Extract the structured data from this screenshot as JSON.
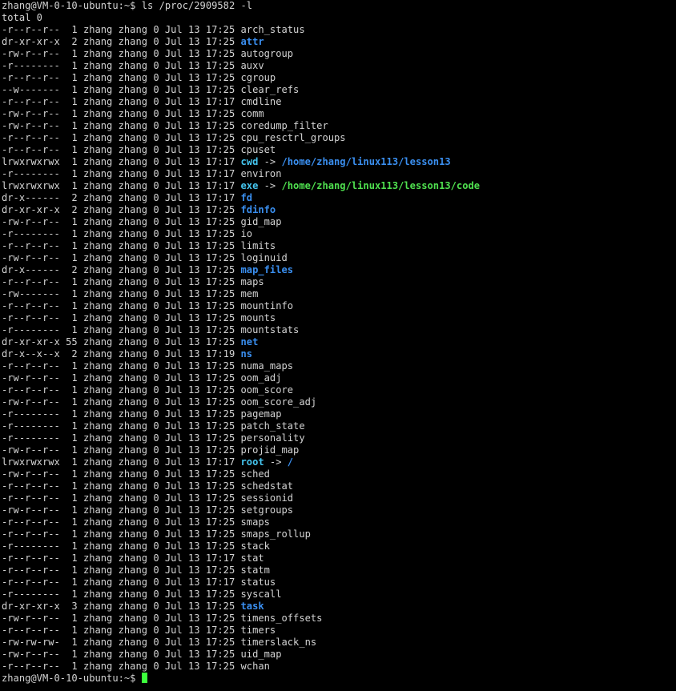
{
  "prompt": "zhang@VM-0-10-ubuntu:~$",
  "command": " ls /proc/2909582 -l",
  "total_line": "total 0",
  "entries": [
    {
      "perm": "-r--r--r--",
      "links": " 1",
      "owner": "zhang",
      "group": "zhang",
      "size": "0",
      "month": "Jul",
      "day": "13",
      "time": "17:25",
      "name": "arch_status",
      "type": "file"
    },
    {
      "perm": "dr-xr-xr-x",
      "links": " 2",
      "owner": "zhang",
      "group": "zhang",
      "size": "0",
      "month": "Jul",
      "day": "13",
      "time": "17:25",
      "name": "attr",
      "type": "dir"
    },
    {
      "perm": "-rw-r--r--",
      "links": " 1",
      "owner": "zhang",
      "group": "zhang",
      "size": "0",
      "month": "Jul",
      "day": "13",
      "time": "17:25",
      "name": "autogroup",
      "type": "file"
    },
    {
      "perm": "-r--------",
      "links": " 1",
      "owner": "zhang",
      "group": "zhang",
      "size": "0",
      "month": "Jul",
      "day": "13",
      "time": "17:25",
      "name": "auxv",
      "type": "file"
    },
    {
      "perm": "-r--r--r--",
      "links": " 1",
      "owner": "zhang",
      "group": "zhang",
      "size": "0",
      "month": "Jul",
      "day": "13",
      "time": "17:25",
      "name": "cgroup",
      "type": "file"
    },
    {
      "perm": "--w-------",
      "links": " 1",
      "owner": "zhang",
      "group": "zhang",
      "size": "0",
      "month": "Jul",
      "day": "13",
      "time": "17:25",
      "name": "clear_refs",
      "type": "file"
    },
    {
      "perm": "-r--r--r--",
      "links": " 1",
      "owner": "zhang",
      "group": "zhang",
      "size": "0",
      "month": "Jul",
      "day": "13",
      "time": "17:17",
      "name": "cmdline",
      "type": "file"
    },
    {
      "perm": "-rw-r--r--",
      "links": " 1",
      "owner": "zhang",
      "group": "zhang",
      "size": "0",
      "month": "Jul",
      "day": "13",
      "time": "17:25",
      "name": "comm",
      "type": "file"
    },
    {
      "perm": "-rw-r--r--",
      "links": " 1",
      "owner": "zhang",
      "group": "zhang",
      "size": "0",
      "month": "Jul",
      "day": "13",
      "time": "17:25",
      "name": "coredump_filter",
      "type": "file"
    },
    {
      "perm": "-r--r--r--",
      "links": " 1",
      "owner": "zhang",
      "group": "zhang",
      "size": "0",
      "month": "Jul",
      "day": "13",
      "time": "17:25",
      "name": "cpu_resctrl_groups",
      "type": "file"
    },
    {
      "perm": "-r--r--r--",
      "links": " 1",
      "owner": "zhang",
      "group": "zhang",
      "size": "0",
      "month": "Jul",
      "day": "13",
      "time": "17:25",
      "name": "cpuset",
      "type": "file"
    },
    {
      "perm": "lrwxrwxrwx",
      "links": " 1",
      "owner": "zhang",
      "group": "zhang",
      "size": "0",
      "month": "Jul",
      "day": "13",
      "time": "17:17",
      "name": "cwd",
      "type": "link",
      "arrow": " -> ",
      "target": "/home/zhang/linux113/lesson13",
      "target_type": "dir"
    },
    {
      "perm": "-r--------",
      "links": " 1",
      "owner": "zhang",
      "group": "zhang",
      "size": "0",
      "month": "Jul",
      "day": "13",
      "time": "17:17",
      "name": "environ",
      "type": "file"
    },
    {
      "perm": "lrwxrwxrwx",
      "links": " 1",
      "owner": "zhang",
      "group": "zhang",
      "size": "0",
      "month": "Jul",
      "day": "13",
      "time": "17:17",
      "name": "exe",
      "type": "link",
      "arrow": " -> ",
      "target": "/home/zhang/linux113/lesson13/code",
      "target_type": "exec"
    },
    {
      "perm": "dr-x------",
      "links": " 2",
      "owner": "zhang",
      "group": "zhang",
      "size": "0",
      "month": "Jul",
      "day": "13",
      "time": "17:17",
      "name": "fd",
      "type": "dir"
    },
    {
      "perm": "dr-xr-xr-x",
      "links": " 2",
      "owner": "zhang",
      "group": "zhang",
      "size": "0",
      "month": "Jul",
      "day": "13",
      "time": "17:25",
      "name": "fdinfo",
      "type": "dir"
    },
    {
      "perm": "-rw-r--r--",
      "links": " 1",
      "owner": "zhang",
      "group": "zhang",
      "size": "0",
      "month": "Jul",
      "day": "13",
      "time": "17:25",
      "name": "gid_map",
      "type": "file"
    },
    {
      "perm": "-r--------",
      "links": " 1",
      "owner": "zhang",
      "group": "zhang",
      "size": "0",
      "month": "Jul",
      "day": "13",
      "time": "17:25",
      "name": "io",
      "type": "file"
    },
    {
      "perm": "-r--r--r--",
      "links": " 1",
      "owner": "zhang",
      "group": "zhang",
      "size": "0",
      "month": "Jul",
      "day": "13",
      "time": "17:25",
      "name": "limits",
      "type": "file"
    },
    {
      "perm": "-rw-r--r--",
      "links": " 1",
      "owner": "zhang",
      "group": "zhang",
      "size": "0",
      "month": "Jul",
      "day": "13",
      "time": "17:25",
      "name": "loginuid",
      "type": "file"
    },
    {
      "perm": "dr-x------",
      "links": " 2",
      "owner": "zhang",
      "group": "zhang",
      "size": "0",
      "month": "Jul",
      "day": "13",
      "time": "17:25",
      "name": "map_files",
      "type": "dir"
    },
    {
      "perm": "-r--r--r--",
      "links": " 1",
      "owner": "zhang",
      "group": "zhang",
      "size": "0",
      "month": "Jul",
      "day": "13",
      "time": "17:25",
      "name": "maps",
      "type": "file"
    },
    {
      "perm": "-rw-------",
      "links": " 1",
      "owner": "zhang",
      "group": "zhang",
      "size": "0",
      "month": "Jul",
      "day": "13",
      "time": "17:25",
      "name": "mem",
      "type": "file"
    },
    {
      "perm": "-r--r--r--",
      "links": " 1",
      "owner": "zhang",
      "group": "zhang",
      "size": "0",
      "month": "Jul",
      "day": "13",
      "time": "17:25",
      "name": "mountinfo",
      "type": "file"
    },
    {
      "perm": "-r--r--r--",
      "links": " 1",
      "owner": "zhang",
      "group": "zhang",
      "size": "0",
      "month": "Jul",
      "day": "13",
      "time": "17:25",
      "name": "mounts",
      "type": "file"
    },
    {
      "perm": "-r--------",
      "links": " 1",
      "owner": "zhang",
      "group": "zhang",
      "size": "0",
      "month": "Jul",
      "day": "13",
      "time": "17:25",
      "name": "mountstats",
      "type": "file"
    },
    {
      "perm": "dr-xr-xr-x",
      "links": "55",
      "owner": "zhang",
      "group": "zhang",
      "size": "0",
      "month": "Jul",
      "day": "13",
      "time": "17:25",
      "name": "net",
      "type": "dir"
    },
    {
      "perm": "dr-x--x--x",
      "links": " 2",
      "owner": "zhang",
      "group": "zhang",
      "size": "0",
      "month": "Jul",
      "day": "13",
      "time": "17:19",
      "name": "ns",
      "type": "dir"
    },
    {
      "perm": "-r--r--r--",
      "links": " 1",
      "owner": "zhang",
      "group": "zhang",
      "size": "0",
      "month": "Jul",
      "day": "13",
      "time": "17:25",
      "name": "numa_maps",
      "type": "file"
    },
    {
      "perm": "-rw-r--r--",
      "links": " 1",
      "owner": "zhang",
      "group": "zhang",
      "size": "0",
      "month": "Jul",
      "day": "13",
      "time": "17:25",
      "name": "oom_adj",
      "type": "file"
    },
    {
      "perm": "-r--r--r--",
      "links": " 1",
      "owner": "zhang",
      "group": "zhang",
      "size": "0",
      "month": "Jul",
      "day": "13",
      "time": "17:25",
      "name": "oom_score",
      "type": "file"
    },
    {
      "perm": "-rw-r--r--",
      "links": " 1",
      "owner": "zhang",
      "group": "zhang",
      "size": "0",
      "month": "Jul",
      "day": "13",
      "time": "17:25",
      "name": "oom_score_adj",
      "type": "file"
    },
    {
      "perm": "-r--------",
      "links": " 1",
      "owner": "zhang",
      "group": "zhang",
      "size": "0",
      "month": "Jul",
      "day": "13",
      "time": "17:25",
      "name": "pagemap",
      "type": "file"
    },
    {
      "perm": "-r--------",
      "links": " 1",
      "owner": "zhang",
      "group": "zhang",
      "size": "0",
      "month": "Jul",
      "day": "13",
      "time": "17:25",
      "name": "patch_state",
      "type": "file"
    },
    {
      "perm": "-r--------",
      "links": " 1",
      "owner": "zhang",
      "group": "zhang",
      "size": "0",
      "month": "Jul",
      "day": "13",
      "time": "17:25",
      "name": "personality",
      "type": "file"
    },
    {
      "perm": "-rw-r--r--",
      "links": " 1",
      "owner": "zhang",
      "group": "zhang",
      "size": "0",
      "month": "Jul",
      "day": "13",
      "time": "17:25",
      "name": "projid_map",
      "type": "file"
    },
    {
      "perm": "lrwxrwxrwx",
      "links": " 1",
      "owner": "zhang",
      "group": "zhang",
      "size": "0",
      "month": "Jul",
      "day": "13",
      "time": "17:17",
      "name": "root",
      "type": "link",
      "arrow": " -> ",
      "target": "/",
      "target_type": "dir"
    },
    {
      "perm": "-rw-r--r--",
      "links": " 1",
      "owner": "zhang",
      "group": "zhang",
      "size": "0",
      "month": "Jul",
      "day": "13",
      "time": "17:25",
      "name": "sched",
      "type": "file"
    },
    {
      "perm": "-r--r--r--",
      "links": " 1",
      "owner": "zhang",
      "group": "zhang",
      "size": "0",
      "month": "Jul",
      "day": "13",
      "time": "17:25",
      "name": "schedstat",
      "type": "file"
    },
    {
      "perm": "-r--r--r--",
      "links": " 1",
      "owner": "zhang",
      "group": "zhang",
      "size": "0",
      "month": "Jul",
      "day": "13",
      "time": "17:25",
      "name": "sessionid",
      "type": "file"
    },
    {
      "perm": "-rw-r--r--",
      "links": " 1",
      "owner": "zhang",
      "group": "zhang",
      "size": "0",
      "month": "Jul",
      "day": "13",
      "time": "17:25",
      "name": "setgroups",
      "type": "file"
    },
    {
      "perm": "-r--r--r--",
      "links": " 1",
      "owner": "zhang",
      "group": "zhang",
      "size": "0",
      "month": "Jul",
      "day": "13",
      "time": "17:25",
      "name": "smaps",
      "type": "file"
    },
    {
      "perm": "-r--r--r--",
      "links": " 1",
      "owner": "zhang",
      "group": "zhang",
      "size": "0",
      "month": "Jul",
      "day": "13",
      "time": "17:25",
      "name": "smaps_rollup",
      "type": "file"
    },
    {
      "perm": "-r--------",
      "links": " 1",
      "owner": "zhang",
      "group": "zhang",
      "size": "0",
      "month": "Jul",
      "day": "13",
      "time": "17:25",
      "name": "stack",
      "type": "file"
    },
    {
      "perm": "-r--r--r--",
      "links": " 1",
      "owner": "zhang",
      "group": "zhang",
      "size": "0",
      "month": "Jul",
      "day": "13",
      "time": "17:17",
      "name": "stat",
      "type": "file"
    },
    {
      "perm": "-r--r--r--",
      "links": " 1",
      "owner": "zhang",
      "group": "zhang",
      "size": "0",
      "month": "Jul",
      "day": "13",
      "time": "17:25",
      "name": "statm",
      "type": "file"
    },
    {
      "perm": "-r--r--r--",
      "links": " 1",
      "owner": "zhang",
      "group": "zhang",
      "size": "0",
      "month": "Jul",
      "day": "13",
      "time": "17:17",
      "name": "status",
      "type": "file"
    },
    {
      "perm": "-r--------",
      "links": " 1",
      "owner": "zhang",
      "group": "zhang",
      "size": "0",
      "month": "Jul",
      "day": "13",
      "time": "17:25",
      "name": "syscall",
      "type": "file"
    },
    {
      "perm": "dr-xr-xr-x",
      "links": " 3",
      "owner": "zhang",
      "group": "zhang",
      "size": "0",
      "month": "Jul",
      "day": "13",
      "time": "17:25",
      "name": "task",
      "type": "dir"
    },
    {
      "perm": "-rw-r--r--",
      "links": " 1",
      "owner": "zhang",
      "group": "zhang",
      "size": "0",
      "month": "Jul",
      "day": "13",
      "time": "17:25",
      "name": "timens_offsets",
      "type": "file"
    },
    {
      "perm": "-r--r--r--",
      "links": " 1",
      "owner": "zhang",
      "group": "zhang",
      "size": "0",
      "month": "Jul",
      "day": "13",
      "time": "17:25",
      "name": "timers",
      "type": "file"
    },
    {
      "perm": "-rw-rw-rw-",
      "links": " 1",
      "owner": "zhang",
      "group": "zhang",
      "size": "0",
      "month": "Jul",
      "day": "13",
      "time": "17:25",
      "name": "timerslack_ns",
      "type": "file"
    },
    {
      "perm": "-rw-r--r--",
      "links": " 1",
      "owner": "zhang",
      "group": "zhang",
      "size": "0",
      "month": "Jul",
      "day": "13",
      "time": "17:25",
      "name": "uid_map",
      "type": "file"
    },
    {
      "perm": "-r--r--r--",
      "links": " 1",
      "owner": "zhang",
      "group": "zhang",
      "size": "0",
      "month": "Jul",
      "day": "13",
      "time": "17:25",
      "name": "wchan",
      "type": "file"
    }
  ],
  "final_prompt": "zhang@VM-0-10-ubuntu:~$",
  "final_input": " ",
  "colors": {
    "background": "#000000",
    "text": "#d3d3d3",
    "directory": "#3a8ff0",
    "symlink": "#45c6f0",
    "executable": "#4fe04f",
    "cursor": "#3cff3c"
  }
}
